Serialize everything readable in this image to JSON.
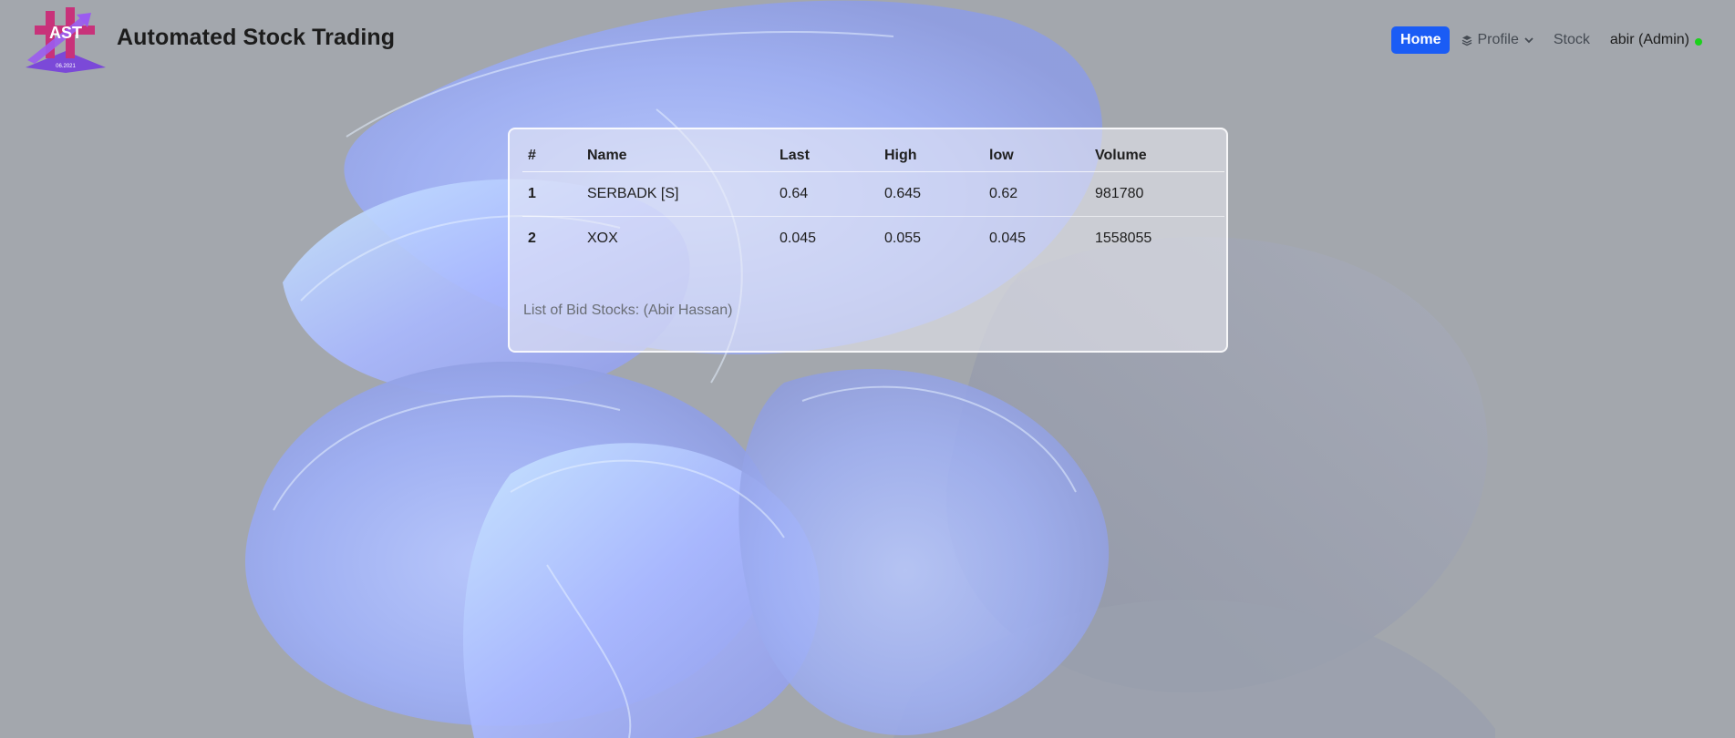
{
  "navbar": {
    "logo": {
      "text": "AST",
      "subtext": "06.2021"
    },
    "brand": "Automated Stock Trading",
    "links": {
      "home": "Home",
      "profile": "Profile",
      "stock": "Stock",
      "user": "abir (Admin)"
    },
    "icons": {
      "profile": "layers-icon",
      "profile_dropdown": "chevron-down-icon",
      "user_status": "online-status-dot"
    },
    "colors": {
      "home_active": "#1a5cf5",
      "online": "#1bd11b"
    }
  },
  "table": {
    "headers": [
      "#",
      "Name",
      "Last",
      "High",
      "low",
      "Volume"
    ],
    "rows": [
      [
        "1",
        "SERBADK [S]",
        "0.64",
        "0.645",
        "0.62",
        "981780"
      ],
      [
        "2",
        "XOX",
        "0.045",
        "0.055",
        "0.045",
        "1558055"
      ]
    ],
    "caption": "List of Bid Stocks: (Abir Hassan)"
  }
}
